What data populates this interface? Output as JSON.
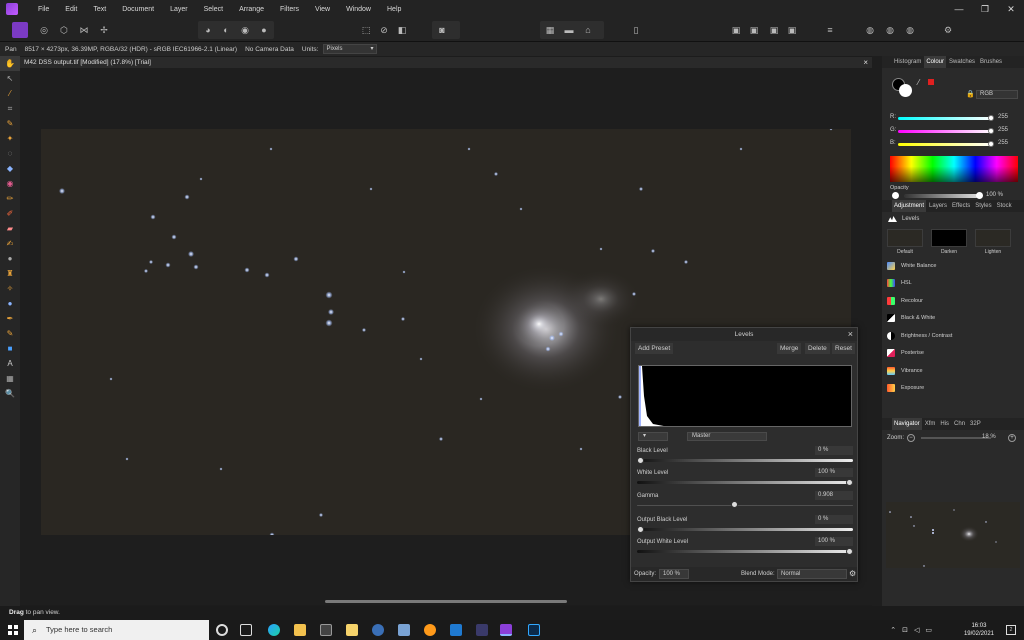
{
  "menubar": {
    "items": [
      "File",
      "Edit",
      "Text",
      "Document",
      "Layer",
      "Select",
      "Arrange",
      "Filters",
      "View",
      "Window",
      "Help"
    ],
    "window_controls": [
      "—",
      "❐",
      "✕"
    ]
  },
  "context": {
    "tool": "Pan",
    "info": "8517 × 4273px, 36.39MP, RGBA/32 (HDR) - sRGB IEC61966-2.1 (Linear)",
    "camera": "No Camera Data",
    "units_label": "Units:",
    "units_value": "Pixels"
  },
  "document": {
    "tab_title": "M42 DSS output.tif [Modified] (17.8%) [Trial]",
    "close": "×"
  },
  "status": {
    "action": "Drag",
    "message": "to pan view."
  },
  "colour_panel": {
    "tabs": [
      "Histogram",
      "Colour",
      "Swatches",
      "Brushes"
    ],
    "active_tab": "Colour",
    "model": "RGB",
    "channels": [
      {
        "label": "R:",
        "value": "255"
      },
      {
        "label": "G:",
        "value": "255"
      },
      {
        "label": "B:",
        "value": "255"
      }
    ],
    "opacity_label": "Opacity",
    "opacity_value": "100 %"
  },
  "adjustment_panel": {
    "tabs": [
      "Adjustment",
      "Layers",
      "Effects",
      "Styles",
      "Stock"
    ],
    "active_tab": "Adjustment",
    "header": "Levels",
    "presets": [
      "Default",
      "Darken",
      "Lighten"
    ],
    "items": [
      "White Balance",
      "HSL",
      "Recolour",
      "Black & White",
      "Brightness / Contrast",
      "Posterise",
      "Vibrance",
      "Exposure"
    ]
  },
  "navigator_panel": {
    "tabs": [
      "Navigator",
      "Xfm",
      "His",
      "Chn",
      "32P"
    ],
    "active_tab": "Navigator",
    "zoom_label": "Zoom:",
    "zoom_value": "18 %"
  },
  "levels_dialog": {
    "title": "Levels",
    "add_preset": "Add Preset",
    "merge": "Merge",
    "delete": "Delete",
    "reset": "Reset",
    "channel": "Master",
    "black_level_label": "Black Level",
    "black_level_value": "0 %",
    "white_level_label": "White Level",
    "white_level_value": "100 %",
    "gamma_label": "Gamma",
    "gamma_value": "0.908",
    "output_black_label": "Output Black Level",
    "output_black_value": "0 %",
    "output_white_label": "Output White Level",
    "output_white_value": "100 %",
    "opacity_label": "Opacity:",
    "opacity_value": "100 %",
    "blend_label": "Blend Mode:",
    "blend_value": "Normal"
  },
  "taskbar": {
    "search_placeholder": "Type here to search",
    "time": "16:03",
    "date": "19/02/2021",
    "notifications": "2"
  }
}
